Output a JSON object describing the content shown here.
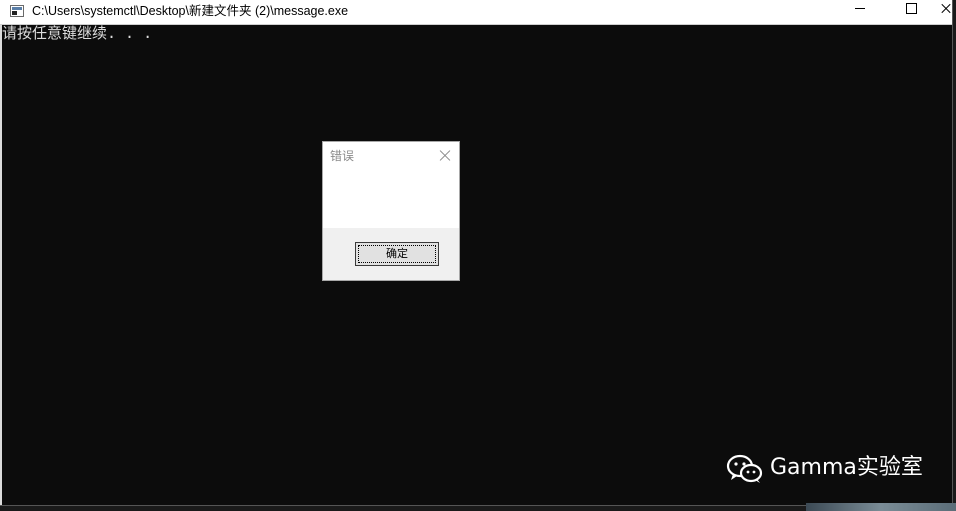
{
  "window": {
    "title": "C:\\Users\\systemctl\\Desktop\\新建文件夹 (2)\\message.exe",
    "icon": "console-app-icon",
    "background_color": "#0c0c0c"
  },
  "console": {
    "output": "请按任意键继续. . ."
  },
  "dialog": {
    "title": "错误",
    "ok_label": "确定"
  },
  "watermark": {
    "text": "Gamma实验室",
    "icon": "wechat-icon"
  }
}
